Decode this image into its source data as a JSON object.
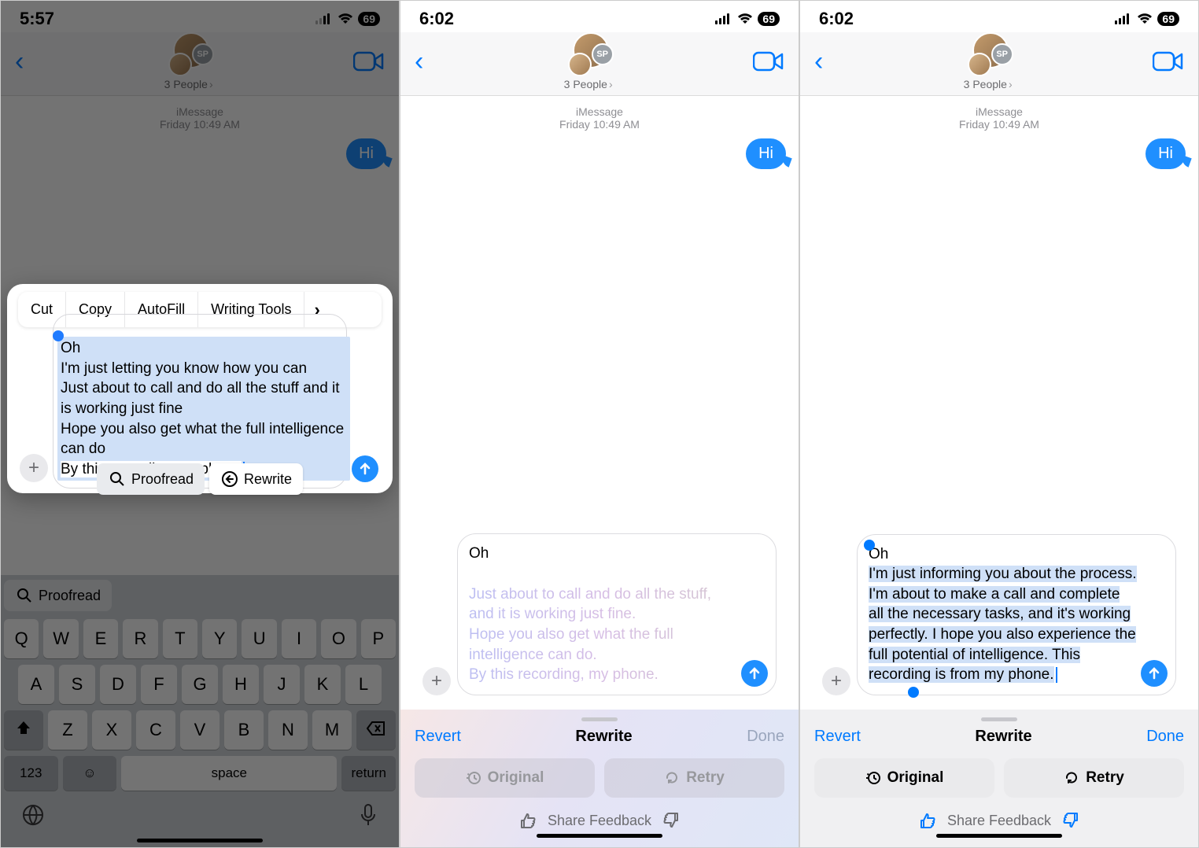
{
  "status": {
    "times": [
      "5:57",
      "6:02",
      "6:02"
    ],
    "battery": "69"
  },
  "header": {
    "people_label": "3 People",
    "sp_badge": "SP"
  },
  "thread": {
    "date_line1": "iMessage",
    "date_line2": "Friday 10:49 AM",
    "out_msg": "Hi"
  },
  "edit_menu": {
    "cut": "Cut",
    "copy": "Copy",
    "autofill": "AutoFill",
    "writing_tools": "Writing Tools"
  },
  "selection_text": {
    "l1": "Oh",
    "l2": "I'm just letting you know how you can",
    "l3": "Just about to call and do all the stuff and it is working just fine",
    "l4": "Hope you also get what the full intelligence can do",
    "l5": "By this recording my phone"
  },
  "suggest": {
    "proofread": "Proofread",
    "rewrite": "Rewrite"
  },
  "keyboard": {
    "row1": [
      "Q",
      "W",
      "E",
      "R",
      "T",
      "Y",
      "U",
      "I",
      "O",
      "P"
    ],
    "row2": [
      "A",
      "S",
      "D",
      "F",
      "G",
      "H",
      "J",
      "K",
      "L"
    ],
    "row3": [
      "Z",
      "X",
      "C",
      "V",
      "B",
      "N",
      "M"
    ],
    "num": "123",
    "space": "space",
    "return": "return"
  },
  "phone2_input": {
    "first": "Oh",
    "ghost": "Just about to call and do all the stuff, and it is working just fine.\nHope you also get what the full intelligence can do.\nBy this recording, my phone."
  },
  "phone3_input": {
    "first": "Oh",
    "body": "I'm just informing you about the process. I'm about to make a call and complete all the necessary tasks, and it's working perfectly. I hope you also experience the full potential of intelligence. This recording is from my phone."
  },
  "panel": {
    "revert": "Revert",
    "title": "Rewrite",
    "done": "Done",
    "original": "Original",
    "retry": "Retry",
    "feedback": "Share Feedback"
  }
}
